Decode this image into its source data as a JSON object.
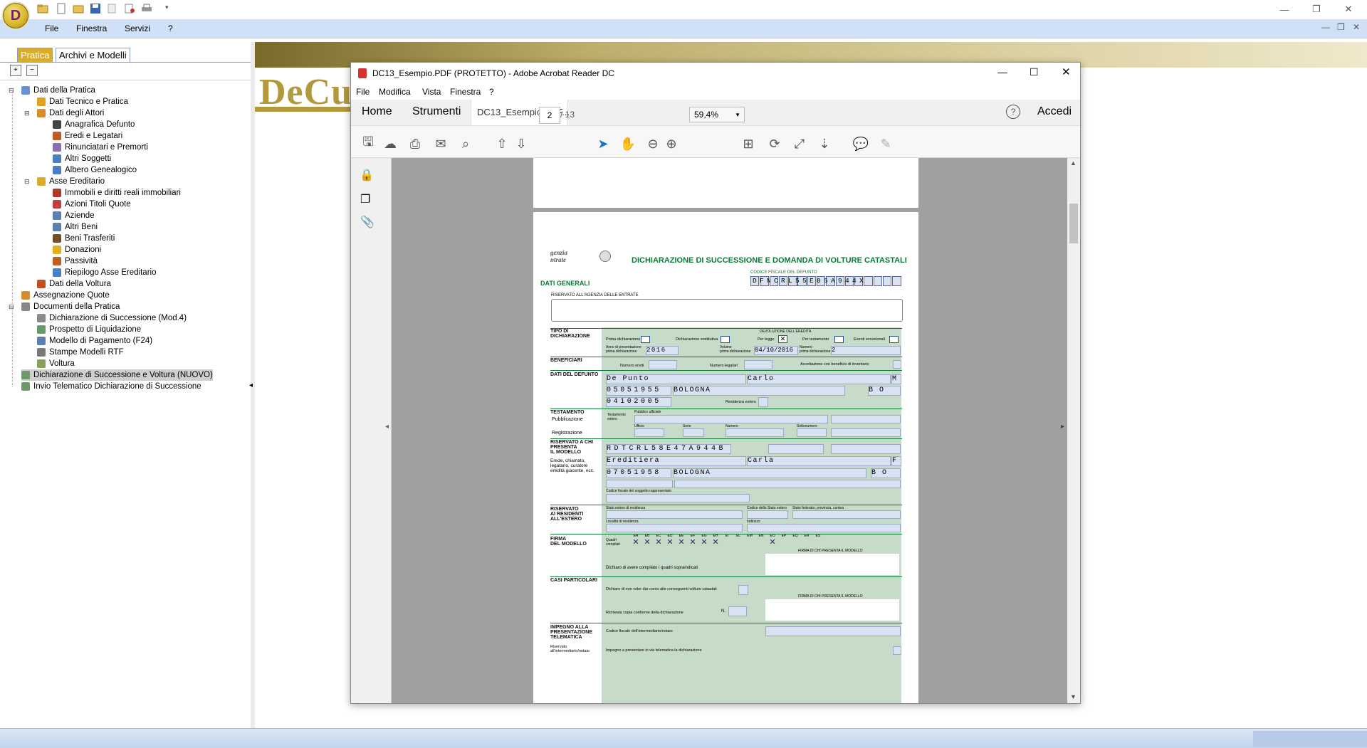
{
  "app": {
    "orb_letter": "D",
    "menu": [
      "File",
      "Finestra",
      "Servizi",
      "?"
    ]
  },
  "left": {
    "tabs": [
      "Pratica",
      "Archivi e Modelli"
    ],
    "tree": [
      {
        "label": "Dati della Pratica",
        "level": 0,
        "expander": "⊟",
        "icon": "document-icon",
        "color": "#6b8fd1"
      },
      {
        "label": "Dati Tecnico e Pratica",
        "level": 1,
        "icon": "person-icon",
        "color": "#e0a020"
      },
      {
        "label": "Dati degli Attori",
        "level": 1,
        "expander": "⊟",
        "icon": "people-icon",
        "color": "#d98c2b"
      },
      {
        "label": "Anagrafica Defunto",
        "level": 2,
        "icon": "person-icon",
        "color": "#444444"
      },
      {
        "label": "Eredi e Legatari",
        "level": 2,
        "icon": "people-icon",
        "color": "#c05a2a"
      },
      {
        "label": "Rinunciatari e Premorti",
        "level": 2,
        "icon": "people-icon",
        "color": "#8a6fb0"
      },
      {
        "label": "Altri Soggetti",
        "level": 2,
        "icon": "people-icon",
        "color": "#4a7fc0"
      },
      {
        "label": "Albero Genealogico",
        "level": 2,
        "icon": "tree-icon",
        "color": "#4a7fc0"
      },
      {
        "label": "Asse Ereditario",
        "level": 1,
        "expander": "⊟",
        "icon": "coins-icon",
        "color": "#d9ad2b"
      },
      {
        "label": "Immobili e diritti reali immobiliari",
        "level": 2,
        "icon": "house-icon",
        "color": "#b03a2a"
      },
      {
        "label": "Azioni Titoli Quote",
        "level": 2,
        "icon": "chart-icon",
        "color": "#c04040"
      },
      {
        "label": "Aziende",
        "level": 2,
        "icon": "building-icon",
        "color": "#5a7fb0"
      },
      {
        "label": "Altri Beni",
        "level": 2,
        "icon": "box-icon",
        "color": "#5a7fb0"
      },
      {
        "label": "Beni Trasferiti",
        "level": 2,
        "icon": "briefcase-icon",
        "color": "#7a4a2a"
      },
      {
        "label": "Donazioni",
        "level": 2,
        "icon": "hand-icon",
        "color": "#e0b020"
      },
      {
        "label": "Passività",
        "level": 2,
        "icon": "person-icon",
        "color": "#c06020"
      },
      {
        "label": "Riepilogo Asse Ereditario",
        "level": 2,
        "icon": "list-icon",
        "color": "#4a7fc0"
      },
      {
        "label": "Dati della Voltura",
        "level": 1,
        "icon": "globe-icon",
        "color": "#c05020"
      },
      {
        "label": "Assegnazione Quote",
        "level": 0,
        "icon": "people-icon",
        "color": "#d98c2b"
      },
      {
        "label": "Documenti della Pratica",
        "level": 0,
        "expander": "⊟",
        "icon": "documents-icon",
        "color": "#888888"
      },
      {
        "label": "Dichiarazione di Successione (Mod.4)",
        "level": 1,
        "icon": "form-icon",
        "color": "#8a8a8a"
      },
      {
        "label": "Prospetto di Liquidazione",
        "level": 1,
        "icon": "form-icon",
        "color": "#6a9a6a"
      },
      {
        "label": "Modello di Pagamento (F24)",
        "level": 1,
        "icon": "form-icon",
        "color": "#5a7fb0"
      },
      {
        "label": "Stampe Modelli RTF",
        "level": 1,
        "icon": "form-icon",
        "color": "#7a7a7a"
      },
      {
        "label": "Voltura",
        "level": 1,
        "icon": "form-icon",
        "color": "#8aa060"
      },
      {
        "label": "Dichiarazione di Successione e Voltura (NUOVO)",
        "level": 0,
        "icon": "form-icon",
        "color": "#6a9a6a",
        "selected": true
      },
      {
        "label": "Invio Telematico Dichiarazione di Successione",
        "level": 0,
        "icon": "send-icon",
        "color": "#6a9a6a"
      }
    ]
  },
  "logo": "DeCu",
  "acrobat": {
    "title": "DC13_Esempio.PDF (PROTETTO) - Adobe Acrobat Reader DC",
    "menu": [
      "File",
      "Modifica",
      "Vista",
      "Finestra",
      "?"
    ],
    "nav": {
      "home": "Home",
      "tools": "Strumenti",
      "doc_tab": "DC13_Esempio.PDF...",
      "login": "Accedi"
    },
    "page_current": "2",
    "page_total": "/ 13",
    "zoom": "59,4%"
  },
  "form": {
    "agency": "genzia\nntrate",
    "title": "DICHIARAZIONE DI SUCCESSIONE E DOMANDA DI VOLTURE CATASTALI",
    "section": "DATI GENERALI",
    "cf_label": "CODICE FISCALE DEL DEFUNTO",
    "cf": "DFNCRL55E05A944X",
    "reserved": "RISERVATO ALL'AGENZIA DELLE ENTRATE",
    "rows": {
      "tipo": "TIPO DI\nDICHIARAZIONE",
      "beneficiari": "BENEFICIARI",
      "defunto": "DATI DEL DEFUNTO",
      "testamento": "TESTAMENTO",
      "riservato": "RISERVATO A CHI\nPRESENTA\nIL MODELLO",
      "residenti": "RISERVATO\nAI RESIDENTI\nALL'ESTERO",
      "firma": "FIRMA\nDEL MODELLO",
      "casi": "CASI PARTICOLARI",
      "impegno": "IMPEGNO ALLA\nPRESENTAZIONE\nTELEMATICA"
    },
    "tipo_labels": [
      "Prima dichiarazione",
      "Dichiarazione sostitutiva",
      "Per legge",
      "Per testamento",
      "Eventi eccezionali"
    ],
    "devoluzione": "DEVOLUZIONE DELL'EREDITÀ",
    "anno_label": "Anno di presentazione\nprima dichiarazione",
    "anno": "2016",
    "volume_label": "Volume\nprima dichiarazione",
    "data_prima": "04/10/2016",
    "numero_label": "Numero\nprima dichiarazione",
    "numero": "2",
    "num_eredi": "Numero eredi",
    "num_legatari": "Numero legatari",
    "accettazione": "Accettazione con beneficio di inventario",
    "def_cognome": "De Punto",
    "def_nome": "Carlo",
    "def_sesso": "M",
    "def_nascita": "05051955",
    "def_comune": "BOLOGNA",
    "def_prov": "B O",
    "def_decesso": "04102005",
    "residenza_estero": "Residenza estero",
    "testamento_sub": [
      "Pubblicazione",
      "Registrazione"
    ],
    "test_labels": [
      "Testamento\nestero",
      "Pubblico ufficiale",
      "Ufficio",
      "Serie",
      "Numero",
      "Sottonumero"
    ],
    "ris_cf": "RDTCRL58E47A944B",
    "ris_cognome": "Ereditiera",
    "ris_nome": "Carla",
    "ris_sesso": "F",
    "ris_nascita": "07051958",
    "ris_comune": "BOLOGNA",
    "ris_prov": "B O",
    "ris_desc": "Erede, chiamato,\nlegatario, curatore\neredità giacente, ecc.",
    "ris_sogg_label": "Codice fiscale del soggetto rappresentato",
    "estero_labels": [
      "Stato estero di residenza",
      "Codice dello Stato estero",
      "Stato federato, provincia, contea",
      "Località di residenza",
      "Indirizzo"
    ],
    "quadri_label": "Quadri\ncompilati",
    "quadri": [
      "EA",
      "EB",
      "EC",
      "ED",
      "EE",
      "EF",
      "EG",
      "EH",
      "EI",
      "EL",
      "EM",
      "EN",
      "EO",
      "EP",
      "EQ",
      "ER",
      "ES"
    ],
    "firma_label": "FIRMA DI CHI PRESENTA IL MODELLO",
    "dichiaro": "Dichiaro di avere compilato i quadri sopraindicati",
    "non_voltura": "Dichiaro di non voler dar corso alle conseguenti volture catastali",
    "copia": "Richiesta copia conforme della dichiarazione",
    "n_label": "N.",
    "interm_label": "Codice fiscale dell'intermediario/notaio",
    "impegno_label": "Impegno a presentare in via telematica la dichiarazione",
    "riservato_interm": "Riservato\nall'intermediario/notaio"
  }
}
